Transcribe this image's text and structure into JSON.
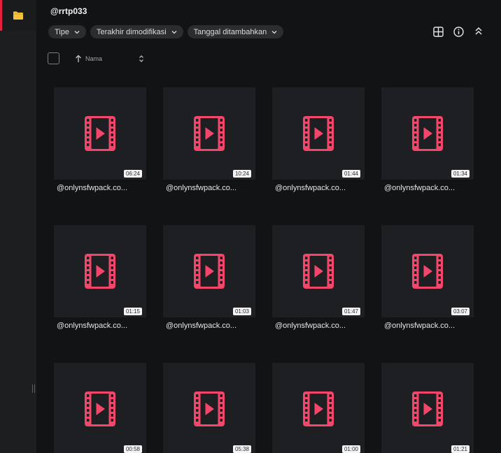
{
  "header": {
    "title": "@rrtp033"
  },
  "filters": [
    {
      "label": "Tipe"
    },
    {
      "label": "Terakhir dimodifikasi"
    },
    {
      "label": "Tanggal ditambahkan"
    }
  ],
  "toolbar": {
    "icons": [
      "grid-view-icon",
      "info-icon",
      "collapse-icon"
    ]
  },
  "sort": {
    "label": "Nama",
    "direction": "ascending"
  },
  "colors": {
    "accent": "#e5213b",
    "video_icon": "#f2476b",
    "folder": "#f5c33b"
  },
  "files": [
    {
      "name": "@onlynsfwpack.co...",
      "duration": "06:24"
    },
    {
      "name": "@onlynsfwpack.co...",
      "duration": "10:24"
    },
    {
      "name": "@onlynsfwpack.co...",
      "duration": "01:44"
    },
    {
      "name": "@onlynsfwpack.co...",
      "duration": "01:34"
    },
    {
      "name": "@onlynsfwpack.co...",
      "duration": "01:15"
    },
    {
      "name": "@onlynsfwpack.co...",
      "duration": "01:03"
    },
    {
      "name": "@onlynsfwpack.co...",
      "duration": "01:47"
    },
    {
      "name": "@onlynsfwpack.co...",
      "duration": "03:07"
    },
    {
      "name": "@onlynsfwpack.co...",
      "duration": "00:58"
    },
    {
      "name": "@onlynsfwpack.co...",
      "duration": "05:38"
    },
    {
      "name": "@onlynsfwpack.co...",
      "duration": "01:00"
    },
    {
      "name": "@onlynsfwpack.co...",
      "duration": "01:21"
    }
  ]
}
